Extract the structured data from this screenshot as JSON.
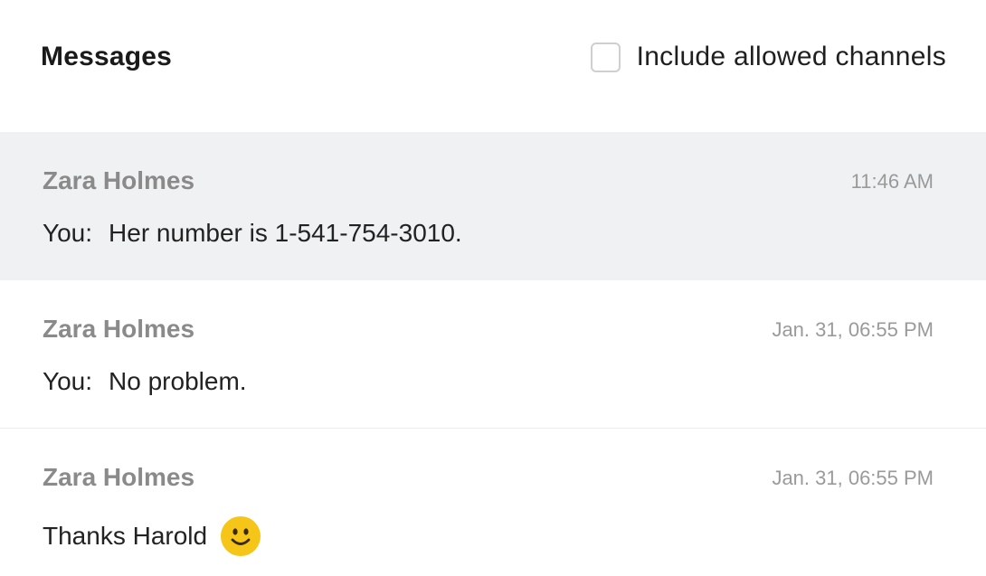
{
  "header": {
    "title": "Messages",
    "filter_label": "Include allowed channels",
    "filter_checked": false
  },
  "messages": [
    {
      "sender": "Zara Holmes",
      "time": "11:46 AM",
      "prefix": "You:",
      "text": "Her number is 1-541-754-3010.",
      "active": true
    },
    {
      "sender": "Zara Holmes",
      "time": "Jan. 31, 06:55 PM",
      "prefix": "You:",
      "text": "No problem.",
      "active": false
    },
    {
      "sender": "Zara Holmes",
      "time": "Jan. 31, 06:55 PM",
      "prefix": "",
      "text": "Thanks Harold",
      "emoji": "slightly-smiling-face-icon",
      "active": false
    }
  ],
  "colors": {
    "active_row_bg": "#f0f1f3",
    "sender_text": "#8a8a8a",
    "time_text": "#9a9a9a",
    "emoji_yellow": "#f5c518"
  }
}
